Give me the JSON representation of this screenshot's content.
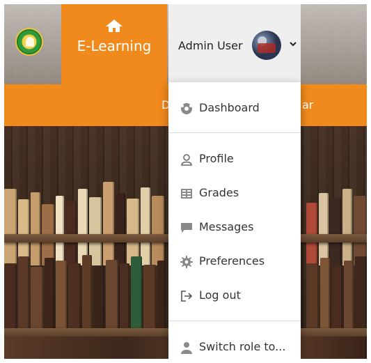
{
  "header": {
    "brand_label": "E-Learning",
    "user_name": "Admin User"
  },
  "band": {
    "fragment_left": "D",
    "fragment_right": "ar"
  },
  "user_menu": {
    "items": [
      {
        "label": "Dashboard",
        "icon": "dashboard-icon"
      },
      {
        "label": "Profile",
        "icon": "user-icon"
      },
      {
        "label": "Grades",
        "icon": "grades-icon"
      },
      {
        "label": "Messages",
        "icon": "message-icon"
      },
      {
        "label": "Preferences",
        "icon": "gear-icon"
      },
      {
        "label": "Log out",
        "icon": "logout-icon"
      },
      {
        "label": "Switch role to...",
        "icon": "user-switch-icon"
      }
    ]
  },
  "colors": {
    "brand_orange": "#f08a1c",
    "menu_icon_gray": "#8a8a8a"
  }
}
